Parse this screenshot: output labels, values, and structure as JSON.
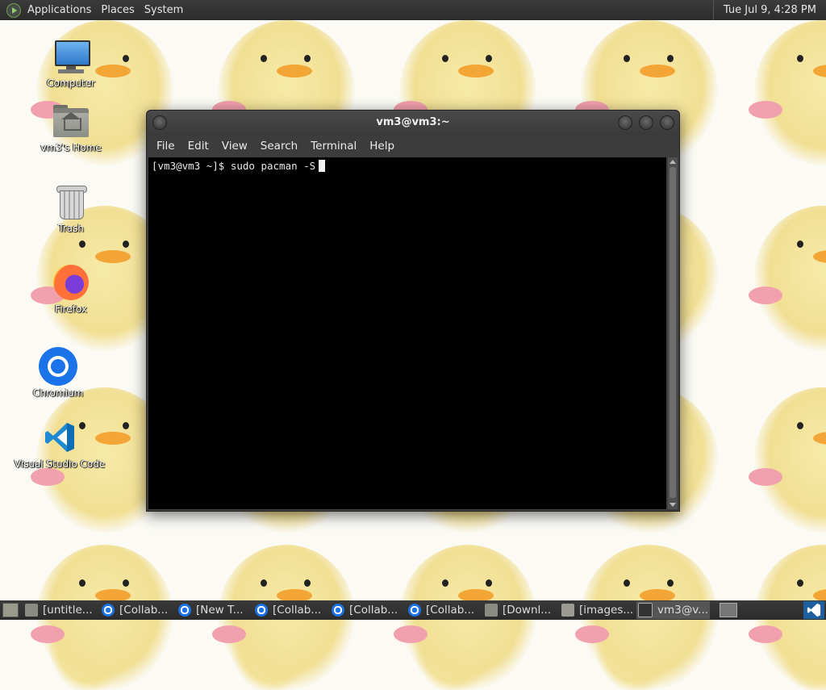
{
  "top_panel": {
    "menus": [
      "Applications",
      "Places",
      "System"
    ],
    "clock": "Tue Jul  9,  4:28 PM"
  },
  "desktop_icons": [
    {
      "label": "Computer",
      "icon": "computer-icon"
    },
    {
      "label": "vm3's Home",
      "icon": "home-folder-icon"
    },
    {
      "label": "Trash",
      "icon": "trash-icon"
    },
    {
      "label": "Firefox",
      "icon": "firefox-icon"
    },
    {
      "label": "Chromium",
      "icon": "chromium-icon"
    },
    {
      "label": "Visual Studio Code",
      "icon": "vscode-icon"
    }
  ],
  "terminal": {
    "title": "vm3@vm3:~",
    "menu": [
      "File",
      "Edit",
      "View",
      "Search",
      "Terminal",
      "Help"
    ],
    "prompt_line": "[vm3@vm3 ~]$ sudo pacman -S"
  },
  "taskbar": {
    "tasks": [
      {
        "label": "[untitle...",
        "icon": "folder-icon"
      },
      {
        "label": "[Collab...",
        "icon": "chromium-icon"
      },
      {
        "label": "[New T...",
        "icon": "chromium-icon"
      },
      {
        "label": "[Collab...",
        "icon": "chromium-icon"
      },
      {
        "label": "[Collab...",
        "icon": "chromium-icon"
      },
      {
        "label": "[Collab...",
        "icon": "chromium-icon"
      },
      {
        "label": "[Downl...",
        "icon": "folder-icon"
      },
      {
        "label": "[images...",
        "icon": "image-icon"
      },
      {
        "label": "vm3@v...",
        "icon": "terminal-icon",
        "active": true
      }
    ]
  }
}
